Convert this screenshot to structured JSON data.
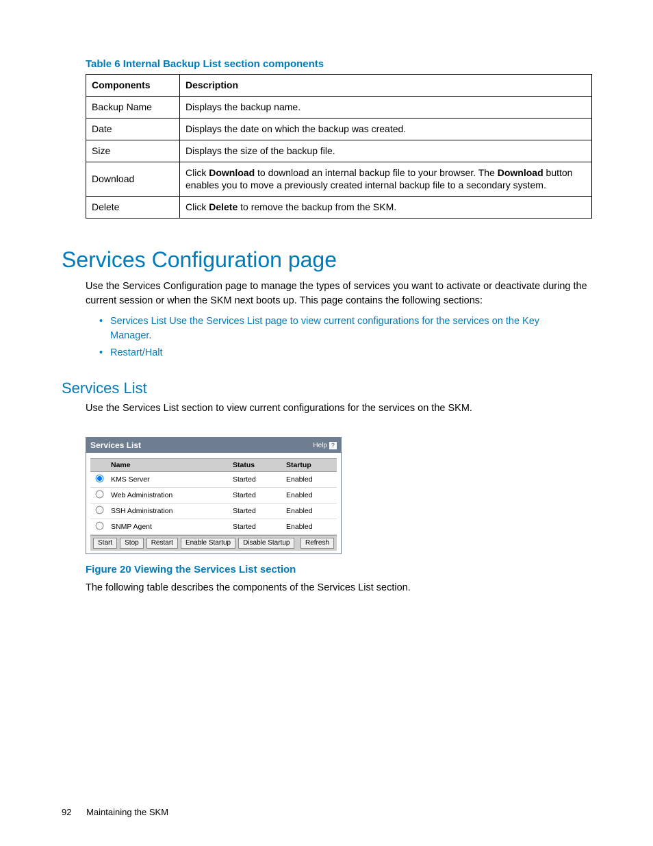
{
  "table6": {
    "caption": "Table 6 Internal Backup List section components",
    "headers": {
      "components": "Components",
      "description": "Description"
    },
    "rows": [
      {
        "component": "Backup Name",
        "description": "Displays the backup name."
      },
      {
        "component": "Date",
        "description": "Displays the date on which the backup was created."
      },
      {
        "component": "Size",
        "description": "Displays the size of the backup file."
      },
      {
        "component": "Download",
        "description_html": "Click <b>Download</b> to download an internal backup file to your browser. The <b>Download</b> button enables you to move a previously created internal backup file to a secondary system."
      },
      {
        "component": "Delete",
        "description_html": "Click <b>Delete</b> to remove the backup from the SKM."
      }
    ]
  },
  "section_h1": "Services Configuration page",
  "section_p1": "Use the Services Configuration page to manage the types of services you want to activate or deactivate during the current session or when the SKM next boots up. This page contains the following sections:",
  "bullets": [
    "Services List Use the Services List page to view current configurations for the services on the Key Manager.",
    "Restart/Halt"
  ],
  "subsection_h2": "Services List",
  "subsection_p1": "Use the Services List section to view current configurations for the services on the SKM.",
  "widget": {
    "title": "Services List",
    "help": "Help",
    "cols": {
      "name": "Name",
      "status": "Status",
      "startup": "Startup"
    },
    "rows": [
      {
        "name": "KMS Server",
        "status": "Started",
        "startup": "Enabled",
        "checked": true
      },
      {
        "name": "Web Administration",
        "status": "Started",
        "startup": "Enabled",
        "checked": false
      },
      {
        "name": "SSH Administration",
        "status": "Started",
        "startup": "Enabled",
        "checked": false
      },
      {
        "name": "SNMP Agent",
        "status": "Started",
        "startup": "Enabled",
        "checked": false
      }
    ],
    "buttons": {
      "start": "Start",
      "stop": "Stop",
      "restart": "Restart",
      "enable": "Enable Startup",
      "disable": "Disable Startup",
      "refresh": "Refresh"
    }
  },
  "figure_caption": "Figure 20 Viewing the Services List section",
  "after_figure_p": "The following table describes the components of the Services List section.",
  "footer": {
    "page": "92",
    "chapter": "Maintaining the SKM"
  }
}
